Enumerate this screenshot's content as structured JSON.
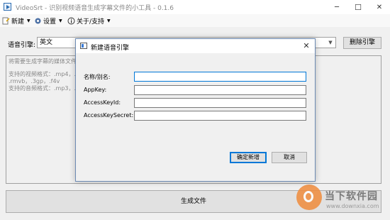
{
  "window": {
    "title": "VideoSrt - 识别视频语音生成字幕文件的小工具 - 0.1.6",
    "minimize_icon": "─",
    "maximize_icon": "☐",
    "close_icon": "✕"
  },
  "menu": {
    "new_label": "新建",
    "settings_label": "设置",
    "about_label": "关于/支持"
  },
  "engine": {
    "label": "语音引擎:",
    "selected": "英文",
    "delete_label": "删除引擎"
  },
  "media_area": {
    "placeholder": "将需要生成字幕的媒体文件",
    "video_formats_line1": "支持的视频格式：.mp4，.",
    "video_formats_line2": ".rmvb，.3gp，.f4v",
    "audio_formats": "支持的音频格式：.mp3，."
  },
  "generate_label": "生成文件",
  "dialog": {
    "title": "新建语音引擎",
    "close_icon": "✕",
    "fields": [
      {
        "label": "名称/别名:",
        "value": ""
      },
      {
        "label": "AppKey:",
        "value": ""
      },
      {
        "label": "AccessKeyId:",
        "value": ""
      },
      {
        "label": "AccessKeySecret:",
        "value": ""
      }
    ],
    "confirm_label": "确定新增",
    "cancel_label": "取消"
  },
  "watermark": {
    "brand": "当下软件园",
    "url": "www.downxia.com"
  },
  "colors": {
    "accent": "#0078d7",
    "watermark_orange": "#f08c3c"
  }
}
